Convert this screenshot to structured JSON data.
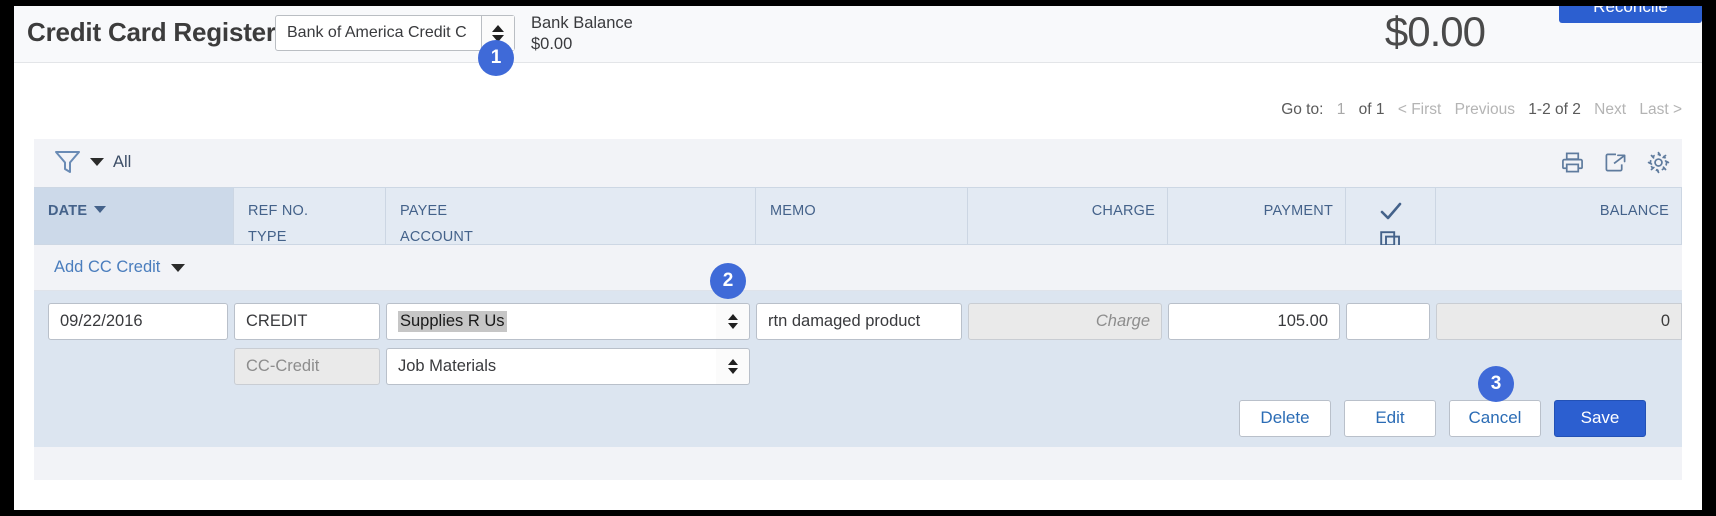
{
  "header": {
    "title": "Credit Card Register",
    "account_select": {
      "value": "Bank of America Credit C",
      "icon": "stepper-icon"
    },
    "bank_balance_label": "Bank Balance",
    "bank_balance_amount": "$0.00",
    "total_amount": "$0.00",
    "reconcile_label": "Reconcile",
    "accent_color": "#2c5fd0"
  },
  "pagination": {
    "goto_label": "Go to:",
    "page_number": "1",
    "of_pages": "of 1",
    "first": "< First",
    "previous": "Previous",
    "range": "1-2 of 2",
    "next": "Next",
    "last": "Last >"
  },
  "filterbar": {
    "filter_icon": "funnel-icon",
    "filter_label": "All",
    "tools": [
      {
        "name": "print-icon",
        "label": "Print"
      },
      {
        "name": "export-icon",
        "label": "Export"
      },
      {
        "name": "gear-icon",
        "label": "Settings"
      }
    ]
  },
  "table": {
    "columns": [
      {
        "line1": "DATE",
        "line2": "",
        "align": "left",
        "sorted": true,
        "sort_dir": "desc"
      },
      {
        "line1": "REF NO.",
        "line2": "TYPE",
        "align": "left",
        "sorted": false
      },
      {
        "line1": "PAYEE",
        "line2": "ACCOUNT",
        "align": "left",
        "sorted": false
      },
      {
        "line1": "MEMO",
        "line2": "",
        "align": "left",
        "sorted": false
      },
      {
        "line1": "CHARGE",
        "line2": "",
        "align": "right",
        "sorted": false
      },
      {
        "line1": "PAYMENT",
        "line2": "",
        "align": "right",
        "sorted": false
      },
      {
        "line1": "check-icon",
        "line2": "copy-icon",
        "align": "center",
        "sorted": false
      },
      {
        "line1": "BALANCE",
        "line2": "",
        "align": "right",
        "sorted": false
      }
    ],
    "add_row_label": "Add CC Credit"
  },
  "edit_row": {
    "date": "09/22/2016",
    "ref_no": "CREDIT",
    "payee": "Supplies R Us",
    "payee_selected": true,
    "memo": "rtn damaged product",
    "charge_placeholder": "Charge",
    "charge_value": "",
    "payment": "105.00",
    "checkmark": "",
    "balance": "0",
    "type": "CC-Credit",
    "account": "Job Materials"
  },
  "actions": {
    "delete": "Delete",
    "edit": "Edit",
    "cancel": "Cancel",
    "save": "Save"
  },
  "callouts": [
    {
      "number": "1"
    },
    {
      "number": "2"
    },
    {
      "number": "3"
    }
  ]
}
